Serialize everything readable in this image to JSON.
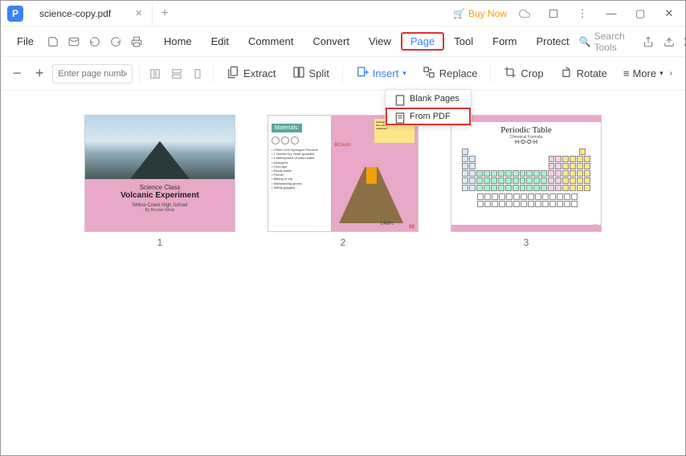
{
  "tab": {
    "title": "science-copy.pdf"
  },
  "titlebar": {
    "buy": "Buy Now"
  },
  "menu": {
    "file": "File",
    "items": [
      "Home",
      "Edit",
      "Comment",
      "Convert",
      "View",
      "Page",
      "Tool",
      "Form",
      "Protect"
    ],
    "search": "Search Tools"
  },
  "toolbar": {
    "page_placeholder": "Enter page number",
    "extract": "Extract",
    "split": "Split",
    "insert": "Insert",
    "replace": "Replace",
    "crop": "Crop",
    "rotate": "Rotate",
    "more": "More"
  },
  "dropdown": {
    "blank": "Blank Pages",
    "from_pdf": "From PDF"
  },
  "thumbs": {
    "p1": "1",
    "p2": "2",
    "p3": "3",
    "slide1": {
      "title": "Science Class",
      "subtitle": "Volcanic Experiment",
      "school": "Willow Creek High School",
      "by": "By Brooke Wells"
    },
    "slide2": {
      "materials": "Materials:",
      "list": "• 125ml 10% Hydrogen Peroxide\n• 1 Sachet Dry Yeast (powder)\n• 4 tablespoons of warm water\n• Detergent\n• Food dye\n• Empty bottle\n• Funnel\n• Baking or tub\n• Dishwashing gloves\n• Safety goggles",
      "boom": "BOoom",
      "note": "Hydrogen peroxide can irritate skin and may be harmful if swallowed",
      "temp": "1,400°c",
      "pg": "02"
    },
    "slide3": {
      "title": "Periodic Table",
      "sub": "Chemical Formula",
      "formula": "H-O-O-H",
      "pg": "03"
    }
  }
}
